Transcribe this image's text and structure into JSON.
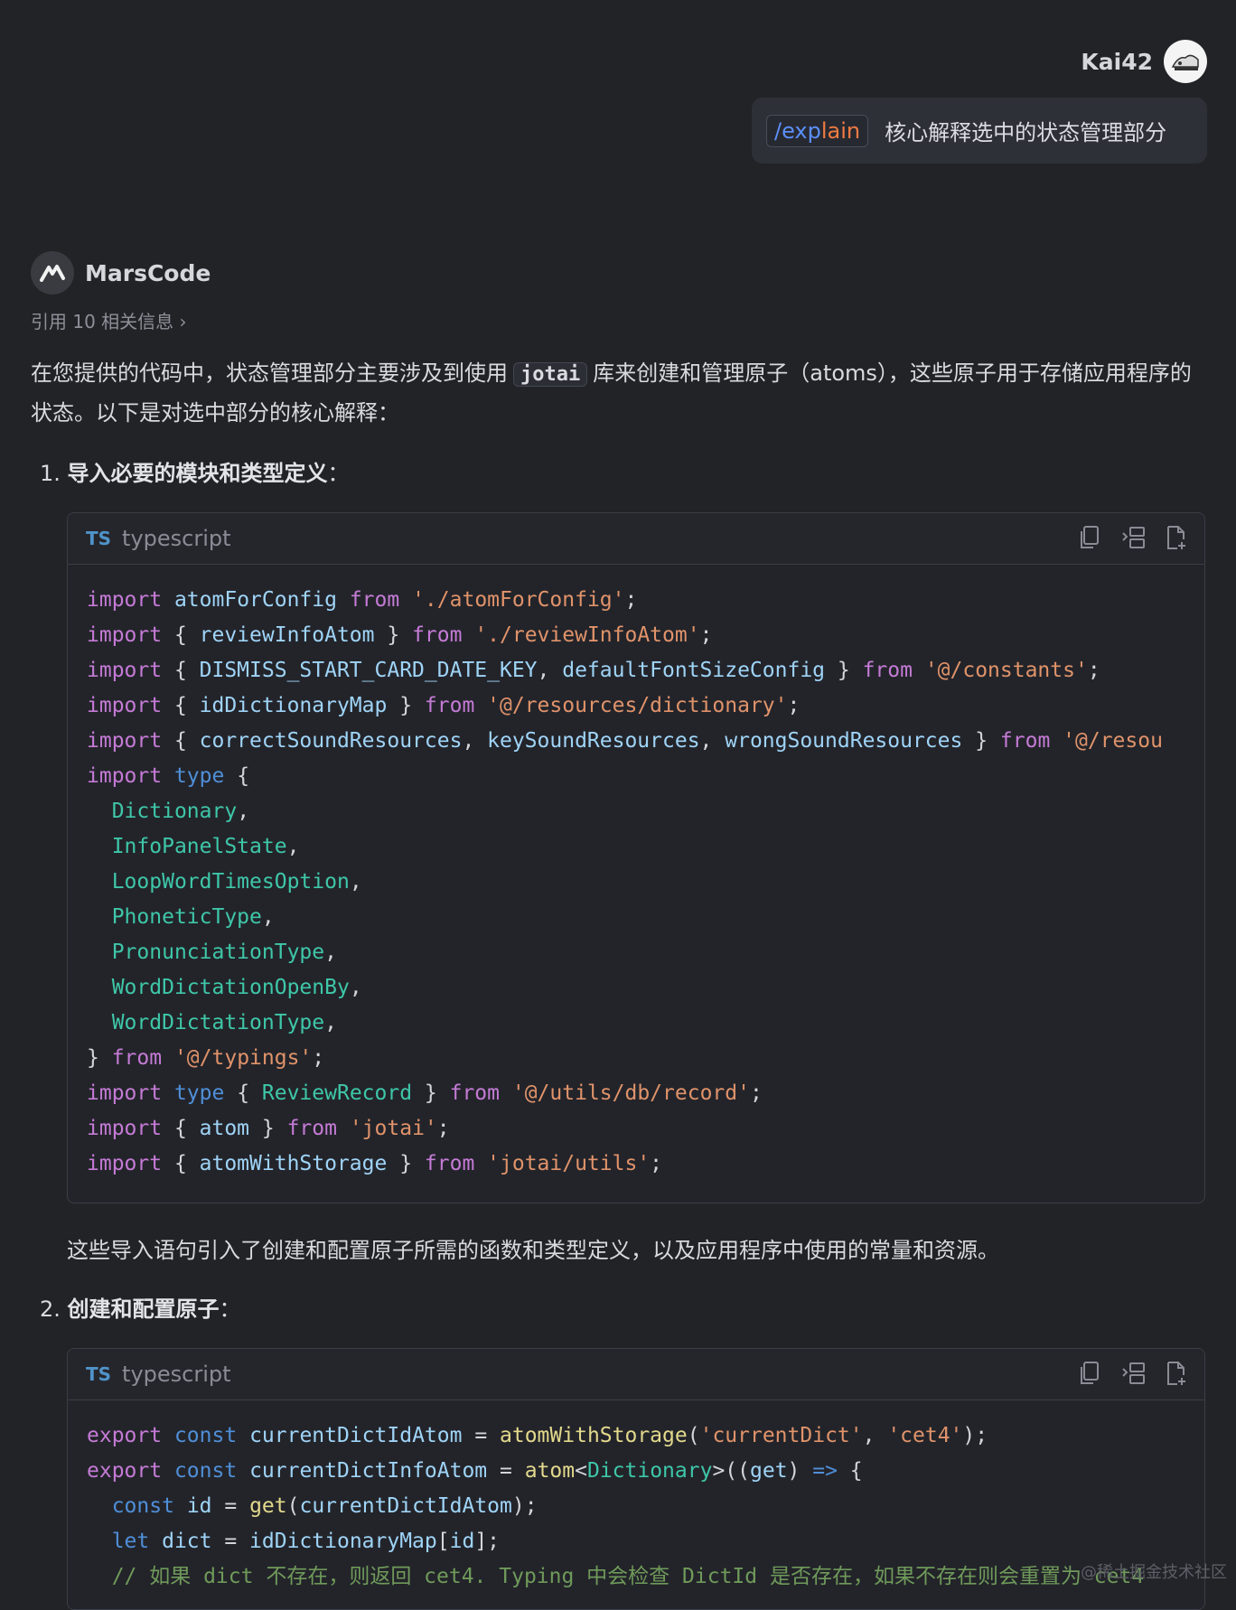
{
  "user": {
    "name": "Kai42"
  },
  "prompt": {
    "command_part1": "/exp",
    "command_part2": "lain",
    "text": "核心解释选中的状态管理部分"
  },
  "bot": {
    "name": "MarsCode"
  },
  "references": {
    "label": "引用 10 相关信息 ›"
  },
  "intro": {
    "before": "在您提供的代码中，状态管理部分主要涉及到使用",
    "code": "jotai",
    "after": "库来创建和管理原子（atoms），这些原子用于存储应用程序的状态。以下是对选中部分的核心解释："
  },
  "sections": [
    {
      "number": "1.",
      "title": "导入必要的模块和类型定义",
      "colon": "："
    },
    {
      "number": "2.",
      "title": "创建和配置原子",
      "colon": "："
    }
  ],
  "code_blocks": [
    {
      "badge": "TS",
      "language": "typescript"
    },
    {
      "badge": "TS",
      "language": "typescript"
    }
  ],
  "section1_after": "这些导入语句引入了创建和配置原子所需的函数和类型定义，以及应用程序中使用的常量和资源。",
  "code_lines": {
    "b1": [
      "import atomForConfig from './atomForConfig';",
      "import { reviewInfoAtom } from './reviewInfoAtom';",
      "import { DISMISS_START_CARD_DATE_KEY, defaultFontSizeConfig } from '@/constants';",
      "import { idDictionaryMap } from '@/resources/dictionary';",
      "import { correctSoundResources, keySoundResources, wrongSoundResources } from '@/resou",
      "import type {",
      "  Dictionary,",
      "  InfoPanelState,",
      "  LoopWordTimesOption,",
      "  PhoneticType,",
      "  PronunciationType,",
      "  WordDictationOpenBy,",
      "  WordDictationType,",
      "} from '@/typings';",
      "import type { ReviewRecord } from '@/utils/db/record';",
      "import { atom } from 'jotai';",
      "import { atomWithStorage } from 'jotai/utils';"
    ],
    "b2": [
      "export const currentDictIdAtom = atomWithStorage('currentDict', 'cet4');",
      "export const currentDictInfoAtom = atom<Dictionary>((get) => {",
      "  const id = get(currentDictIdAtom);",
      "  let dict = idDictionaryMap[id];",
      "  // 如果 dict 不存在，则返回 cet4. Typing 中会检查 DictId 是否存在，如果不存在则会重置为 cet4"
    ]
  },
  "watermark": "@稀土掘金技术社区"
}
